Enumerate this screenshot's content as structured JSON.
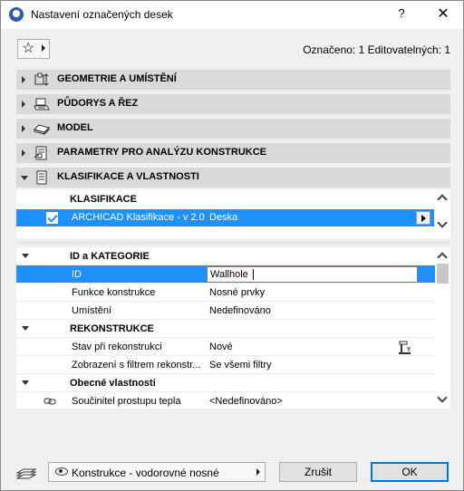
{
  "window": {
    "title": "Nastavení označených desek",
    "help_label": "?",
    "close_label": "✕"
  },
  "toolbar": {
    "favorites_icon": "star-icon",
    "selection_info": "Označeno: 1 Editovatelných: 1"
  },
  "sections": [
    {
      "title": "GEOMETRIE A UMÍSTĚNÍ",
      "icon": "geometry-icon",
      "expanded": false
    },
    {
      "title": "PŮDORYS A ŘEZ",
      "icon": "floorplan-icon",
      "expanded": false
    },
    {
      "title": "MODEL",
      "icon": "model-icon",
      "expanded": false
    },
    {
      "title": "PARAMETRY PRO ANALÝZU KONSTRUKCE",
      "icon": "structural-analysis-icon",
      "expanded": false
    },
    {
      "title": "KLASIFIKACE A VLASTNOSTI",
      "icon": "classification-icon",
      "expanded": true
    }
  ],
  "classification": {
    "header": "KLASIFIKACE",
    "rows": [
      {
        "checked": true,
        "system": "ARCHICAD Klasifikace - v 2.0",
        "value": "Deska"
      }
    ]
  },
  "properties": {
    "groups": [
      {
        "title": "ID a KATEGORIE",
        "rows": [
          {
            "name": "ID",
            "value": "Wallhole",
            "selected": true
          },
          {
            "name": "Funkce konstrukce",
            "value": "Nosné prvky"
          },
          {
            "name": "Umístění",
            "value": "Nedefinováno"
          }
        ]
      },
      {
        "title": "REKONSTRUKCE",
        "rows": [
          {
            "name": "Stav při rekonstrukci",
            "value": "Nové"
          },
          {
            "name": "Zobrazení s filtrem rekonstr...",
            "value": "Se všemi filtry"
          }
        ]
      },
      {
        "title": "Obecné vlastnosti",
        "rows": [
          {
            "name": "Součinitel prostupu tepla",
            "value": "<Nedefinováno>"
          }
        ]
      }
    ]
  },
  "footer": {
    "layer_label": "Konstrukce - vodorovné nosné",
    "cancel_label": "Zrušit",
    "ok_label": "OK"
  },
  "colors": {
    "selection": "#1e90ff",
    "section_bg": "#d9d9d9",
    "ok_border": "#0078d7"
  }
}
